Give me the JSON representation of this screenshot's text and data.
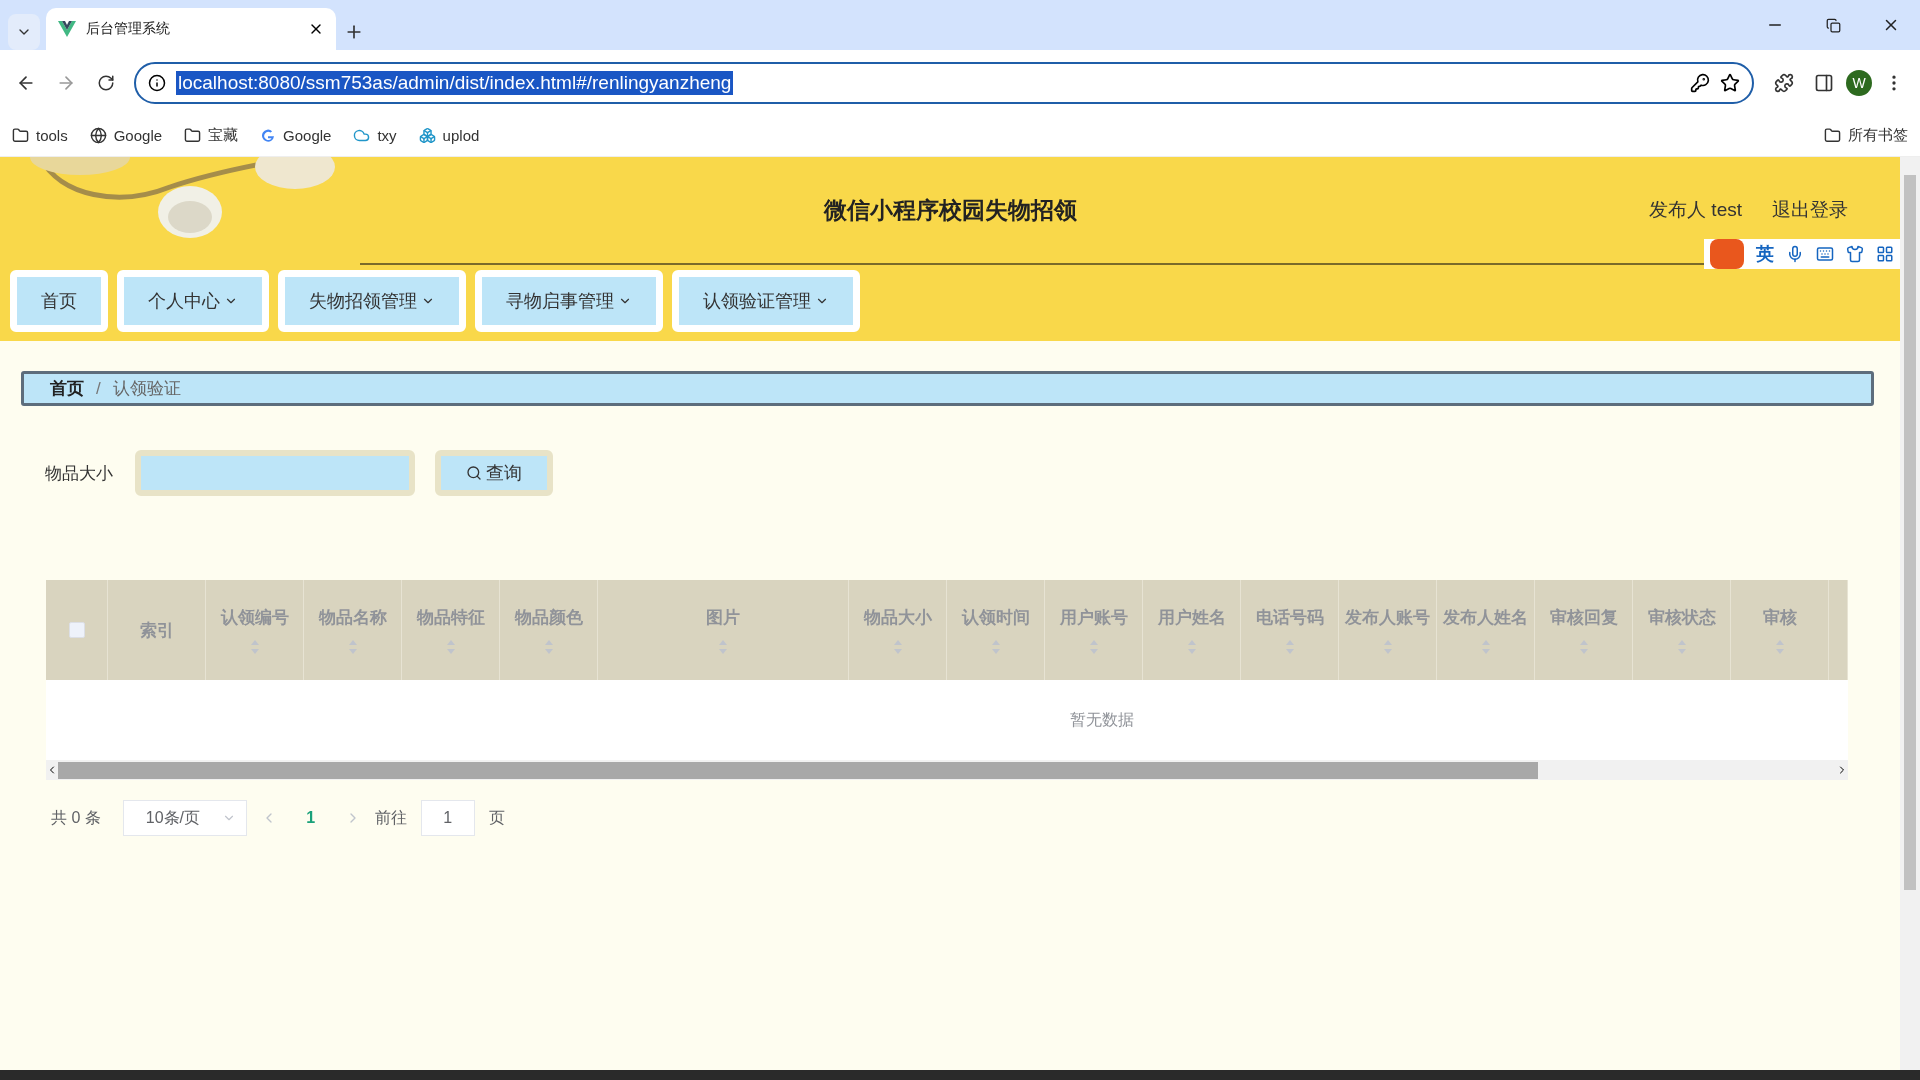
{
  "browser": {
    "tab_title": "后台管理系统",
    "url": "localhost:8080/ssm753as/admin/dist/index.html#/renlingyanzheng",
    "profile": "W",
    "bookmarks": [
      {
        "label": "tools",
        "kind": "folder"
      },
      {
        "label": "Google",
        "kind": "globe"
      },
      {
        "label": "宝藏",
        "kind": "folder"
      },
      {
        "label": "Google",
        "kind": "google"
      },
      {
        "label": "txy",
        "kind": "cloud"
      },
      {
        "label": "uplod",
        "kind": "app"
      }
    ],
    "all_bookmarks": "所有书签"
  },
  "header": {
    "title": "微信小程序校园失物招领",
    "user": "发布人 test",
    "logout": "退出登录"
  },
  "ime": {
    "mode": "英"
  },
  "nav": [
    {
      "label": "首页",
      "dropdown": false
    },
    {
      "label": "个人中心",
      "dropdown": true
    },
    {
      "label": "失物招领管理",
      "dropdown": true
    },
    {
      "label": "寻物启事管理",
      "dropdown": true
    },
    {
      "label": "认领验证管理",
      "dropdown": true
    }
  ],
  "breadcrumb_separator": "/",
  "breadcrumb": [
    {
      "label": "首页",
      "current": false
    },
    {
      "label": "认领验证",
      "current": true
    }
  ],
  "search": {
    "label": "物品大小",
    "button": "查询"
  },
  "table": {
    "columns": [
      {
        "label": "索引",
        "sortable": false,
        "wide": false
      },
      {
        "label": "认领编号",
        "sortable": true,
        "wide": false
      },
      {
        "label": "物品名称",
        "sortable": true,
        "wide": false
      },
      {
        "label": "物品特征",
        "sortable": true,
        "wide": false
      },
      {
        "label": "物品颜色",
        "sortable": true,
        "wide": false
      },
      {
        "label": "图片",
        "sortable": true,
        "wide": true
      },
      {
        "label": "物品大小",
        "sortable": true,
        "wide": false
      },
      {
        "label": "认领时间",
        "sortable": true,
        "wide": false
      },
      {
        "label": "用户账号",
        "sortable": true,
        "wide": false
      },
      {
        "label": "用户姓名",
        "sortable": true,
        "wide": false
      },
      {
        "label": "电话号码",
        "sortable": true,
        "wide": false
      },
      {
        "label": "发布人账号",
        "sortable": true,
        "wide": false
      },
      {
        "label": "发布人姓名",
        "sortable": true,
        "wide": false
      },
      {
        "label": "审核回复",
        "sortable": true,
        "wide": false
      },
      {
        "label": "审核状态",
        "sortable": true,
        "wide": false
      },
      {
        "label": "审核",
        "sortable": true,
        "wide": false
      }
    ],
    "select_all_checked": false,
    "empty_text": "暂无数据"
  },
  "pagination": {
    "total": "共 0 条",
    "page_size": "10条/页",
    "pages": [
      {
        "label": "1",
        "selected": true
      }
    ],
    "goto_label": "前往",
    "goto_value": "1",
    "suffix": "页"
  }
}
